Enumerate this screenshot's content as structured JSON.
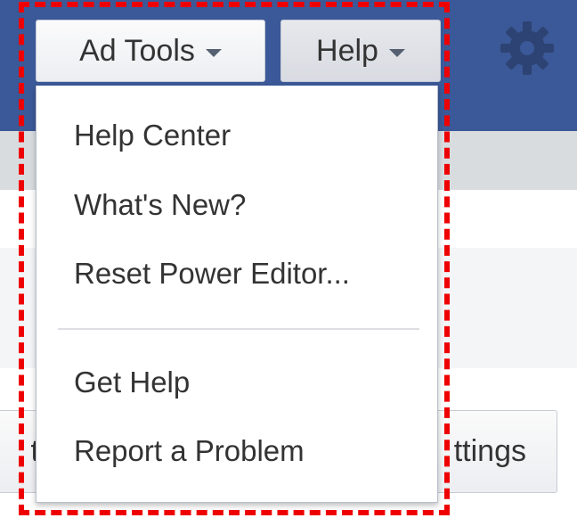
{
  "toolbar": {
    "ad_tools_label": "Ad Tools",
    "help_label": "Help",
    "settings_icon": "gear-icon"
  },
  "help_menu": {
    "items": [
      {
        "label": "Help Center"
      },
      {
        "label": "What's New?"
      },
      {
        "label": "Reset Power Editor..."
      },
      {
        "label": "Get Help"
      },
      {
        "label": "Report a Problem"
      }
    ]
  },
  "background": {
    "left_button_fragment": "ts",
    "right_button_fragment": "ttings"
  },
  "colors": {
    "header": "#3b5998",
    "highlight": "#ee0000"
  }
}
